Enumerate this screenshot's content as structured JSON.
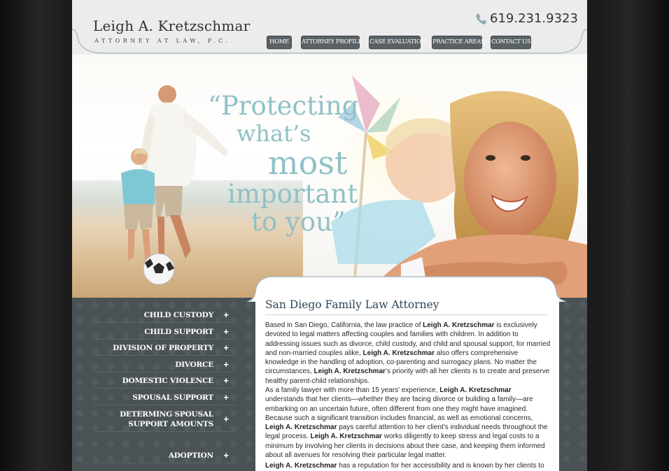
{
  "header": {
    "name": "Leigh A. Kretzschmar",
    "tagline": "ATTORNEY AT LAW, P.C.",
    "phone": "619.231.9323"
  },
  "nav": [
    {
      "label": "HOME"
    },
    {
      "label": "ATTORNEY PROFILE"
    },
    {
      "label": "CASE EVALUATION"
    },
    {
      "label": "PRACTICE AREAS"
    },
    {
      "label": "CONTACT US"
    }
  ],
  "hero": {
    "quote": [
      "“Protecting",
      "what’s",
      "most",
      "important",
      "to you”"
    ]
  },
  "sidebar": {
    "items": [
      {
        "label": "CHILD CUSTODY"
      },
      {
        "label": "CHILD SUPPORT"
      },
      {
        "label": "DIVISION OF PROPERTY"
      },
      {
        "label": "DIVORCE"
      },
      {
        "label": "DOMESTIC VIOLENCE"
      },
      {
        "label": "SPOUSAL SUPPORT"
      },
      {
        "label": "DETERMING SPOUSAL SUPPORT AMOUNTS",
        "line1": "DETERMING SPOUSAL",
        "line2": "SUPPORT AMOUNTS"
      },
      {
        "label": "ADOPTION"
      }
    ],
    "plus": "+"
  },
  "content": {
    "title": "San Diego Family Law Attorney",
    "p1": {
      "t1": "Based in San Diego, California, the law practice of ",
      "b1": "Leigh A. Kretzschmar",
      "t2": " is exclusively devoted to legal matters affecting couples and families with children.  In addition to addressing issues such as divorce, child custody, and child and spousal support, for married and non-married couples alike, ",
      "b2": "Leigh A. Kretzschmar",
      "t3": " also offers comprehensive knowledge in the handling of adoption, co-parenting and surrogacy plans. No matter the circumstances, ",
      "b3": "Leigh A. Kretzschmar",
      "t4": "’s priority with all her clients is to create and preserve healthy parent-child relationships."
    },
    "p2": {
      "t1": "As a family lawyer with more than 15 years’ experience, ",
      "b1": "Leigh A. Kretzschmar",
      "t2": " understands that her clients—whether they are facing divorce or building a family—are embarking on an uncertain future, often different from one they might have imagined. Because such a significant transition includes financial, as well as emotional concerns, ",
      "b2": "Leigh A. Kretzschmar",
      "t3": " pays careful attention to her client’s individual needs throughout the legal process.  ",
      "b3": "Leigh A. Kretzschmar",
      "t4": " works diligently to keep stress and legal costs to a minimum by involving her clients in decisions about their case, and keeping them informed about all avenues for resolving their particular legal matter."
    },
    "p3": {
      "b1": "Leigh A. Kretzschmar",
      "t1": " has a reputation for her accessibility and is known by her clients to be a"
    }
  },
  "colors": {
    "header_bg": "#ececec",
    "nav_bg": "#5b6266",
    "quote": "#8fc1c6",
    "sidebar_bg": "#4a5256",
    "title": "#2e4656"
  },
  "icons": [
    "phone-icon",
    "plus-icon"
  ]
}
